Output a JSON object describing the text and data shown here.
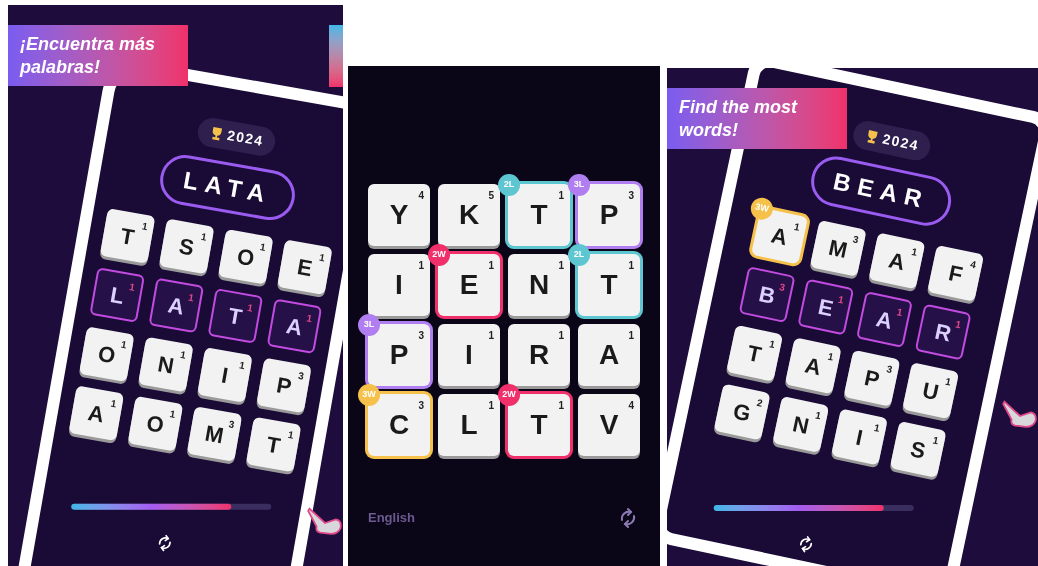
{
  "panels": [
    {
      "kind": "phone",
      "banner": "¡Encuentra más palabras!",
      "badge": "2024",
      "word": "LATA",
      "progress": {
        "level": 0.8
      },
      "tiles": [
        {
          "letter": "T",
          "points": "1",
          "selected": false
        },
        {
          "letter": "S",
          "points": "1",
          "selected": false
        },
        {
          "letter": "O",
          "points": "1",
          "selected": false
        },
        {
          "letter": "E",
          "points": "1",
          "selected": false
        },
        {
          "letter": "L",
          "points": "1",
          "selected": true
        },
        {
          "letter": "A",
          "points": "1",
          "selected": true
        },
        {
          "letter": "T",
          "points": "1",
          "selected": true
        },
        {
          "letter": "A",
          "points": "1",
          "selected": true
        },
        {
          "letter": "O",
          "points": "1",
          "selected": false
        },
        {
          "letter": "N",
          "points": "1",
          "selected": false
        },
        {
          "letter": "I",
          "points": "1",
          "selected": false
        },
        {
          "letter": "P",
          "points": "3",
          "selected": false
        },
        {
          "letter": "A",
          "points": "1",
          "selected": false
        },
        {
          "letter": "O",
          "points": "1",
          "selected": false
        },
        {
          "letter": "M",
          "points": "3",
          "selected": false
        },
        {
          "letter": "T",
          "points": "1",
          "selected": false
        }
      ]
    },
    {
      "kind": "board",
      "language": "English",
      "tiles": [
        {
          "letter": "Y",
          "points": "4"
        },
        {
          "letter": "K",
          "points": "5"
        },
        {
          "letter": "T",
          "points": "1",
          "bonus": "2L",
          "color": "#5ec6d0"
        },
        {
          "letter": "P",
          "points": "3",
          "bonus": "3L",
          "color": "#b07ef0"
        },
        {
          "letter": "I",
          "points": "1"
        },
        {
          "letter": "E",
          "points": "1",
          "bonus": "2W",
          "color": "#f0306a"
        },
        {
          "letter": "N",
          "points": "1"
        },
        {
          "letter": "T",
          "points": "1",
          "bonus": "2L",
          "color": "#5ec6d0"
        },
        {
          "letter": "P",
          "points": "3",
          "bonus": "3L",
          "color": "#b07ef0"
        },
        {
          "letter": "I",
          "points": "1"
        },
        {
          "letter": "R",
          "points": "1"
        },
        {
          "letter": "A",
          "points": "1"
        },
        {
          "letter": "C",
          "points": "3",
          "bonus": "3W",
          "color": "#f5c14a"
        },
        {
          "letter": "L",
          "points": "1"
        },
        {
          "letter": "T",
          "points": "1",
          "bonus": "2W",
          "color": "#f0306a"
        },
        {
          "letter": "V",
          "points": "4"
        }
      ]
    },
    {
      "kind": "tablet",
      "banner": "Find the most words!",
      "badge": "2024",
      "word": "BEAR",
      "progress": {
        "level": 0.85
      },
      "tiles": [
        {
          "letter": "A",
          "points": "1",
          "selected": false,
          "bonus": "3W",
          "color": "#f5c14a"
        },
        {
          "letter": "M",
          "points": "3",
          "selected": false
        },
        {
          "letter": "A",
          "points": "1",
          "selected": false
        },
        {
          "letter": "F",
          "points": "4",
          "selected": false
        },
        {
          "letter": "B",
          "points": "3",
          "selected": true
        },
        {
          "letter": "E",
          "points": "1",
          "selected": true
        },
        {
          "letter": "A",
          "points": "1",
          "selected": true
        },
        {
          "letter": "R",
          "points": "1",
          "selected": true
        },
        {
          "letter": "T",
          "points": "1",
          "selected": false
        },
        {
          "letter": "A",
          "points": "1",
          "selected": false
        },
        {
          "letter": "P",
          "points": "3",
          "selected": false
        },
        {
          "letter": "U",
          "points": "1",
          "selected": false
        },
        {
          "letter": "G",
          "points": "2",
          "selected": false
        },
        {
          "letter": "N",
          "points": "1",
          "selected": false
        },
        {
          "letter": "I",
          "points": "1",
          "selected": false
        },
        {
          "letter": "S",
          "points": "1",
          "selected": false
        }
      ]
    }
  ]
}
